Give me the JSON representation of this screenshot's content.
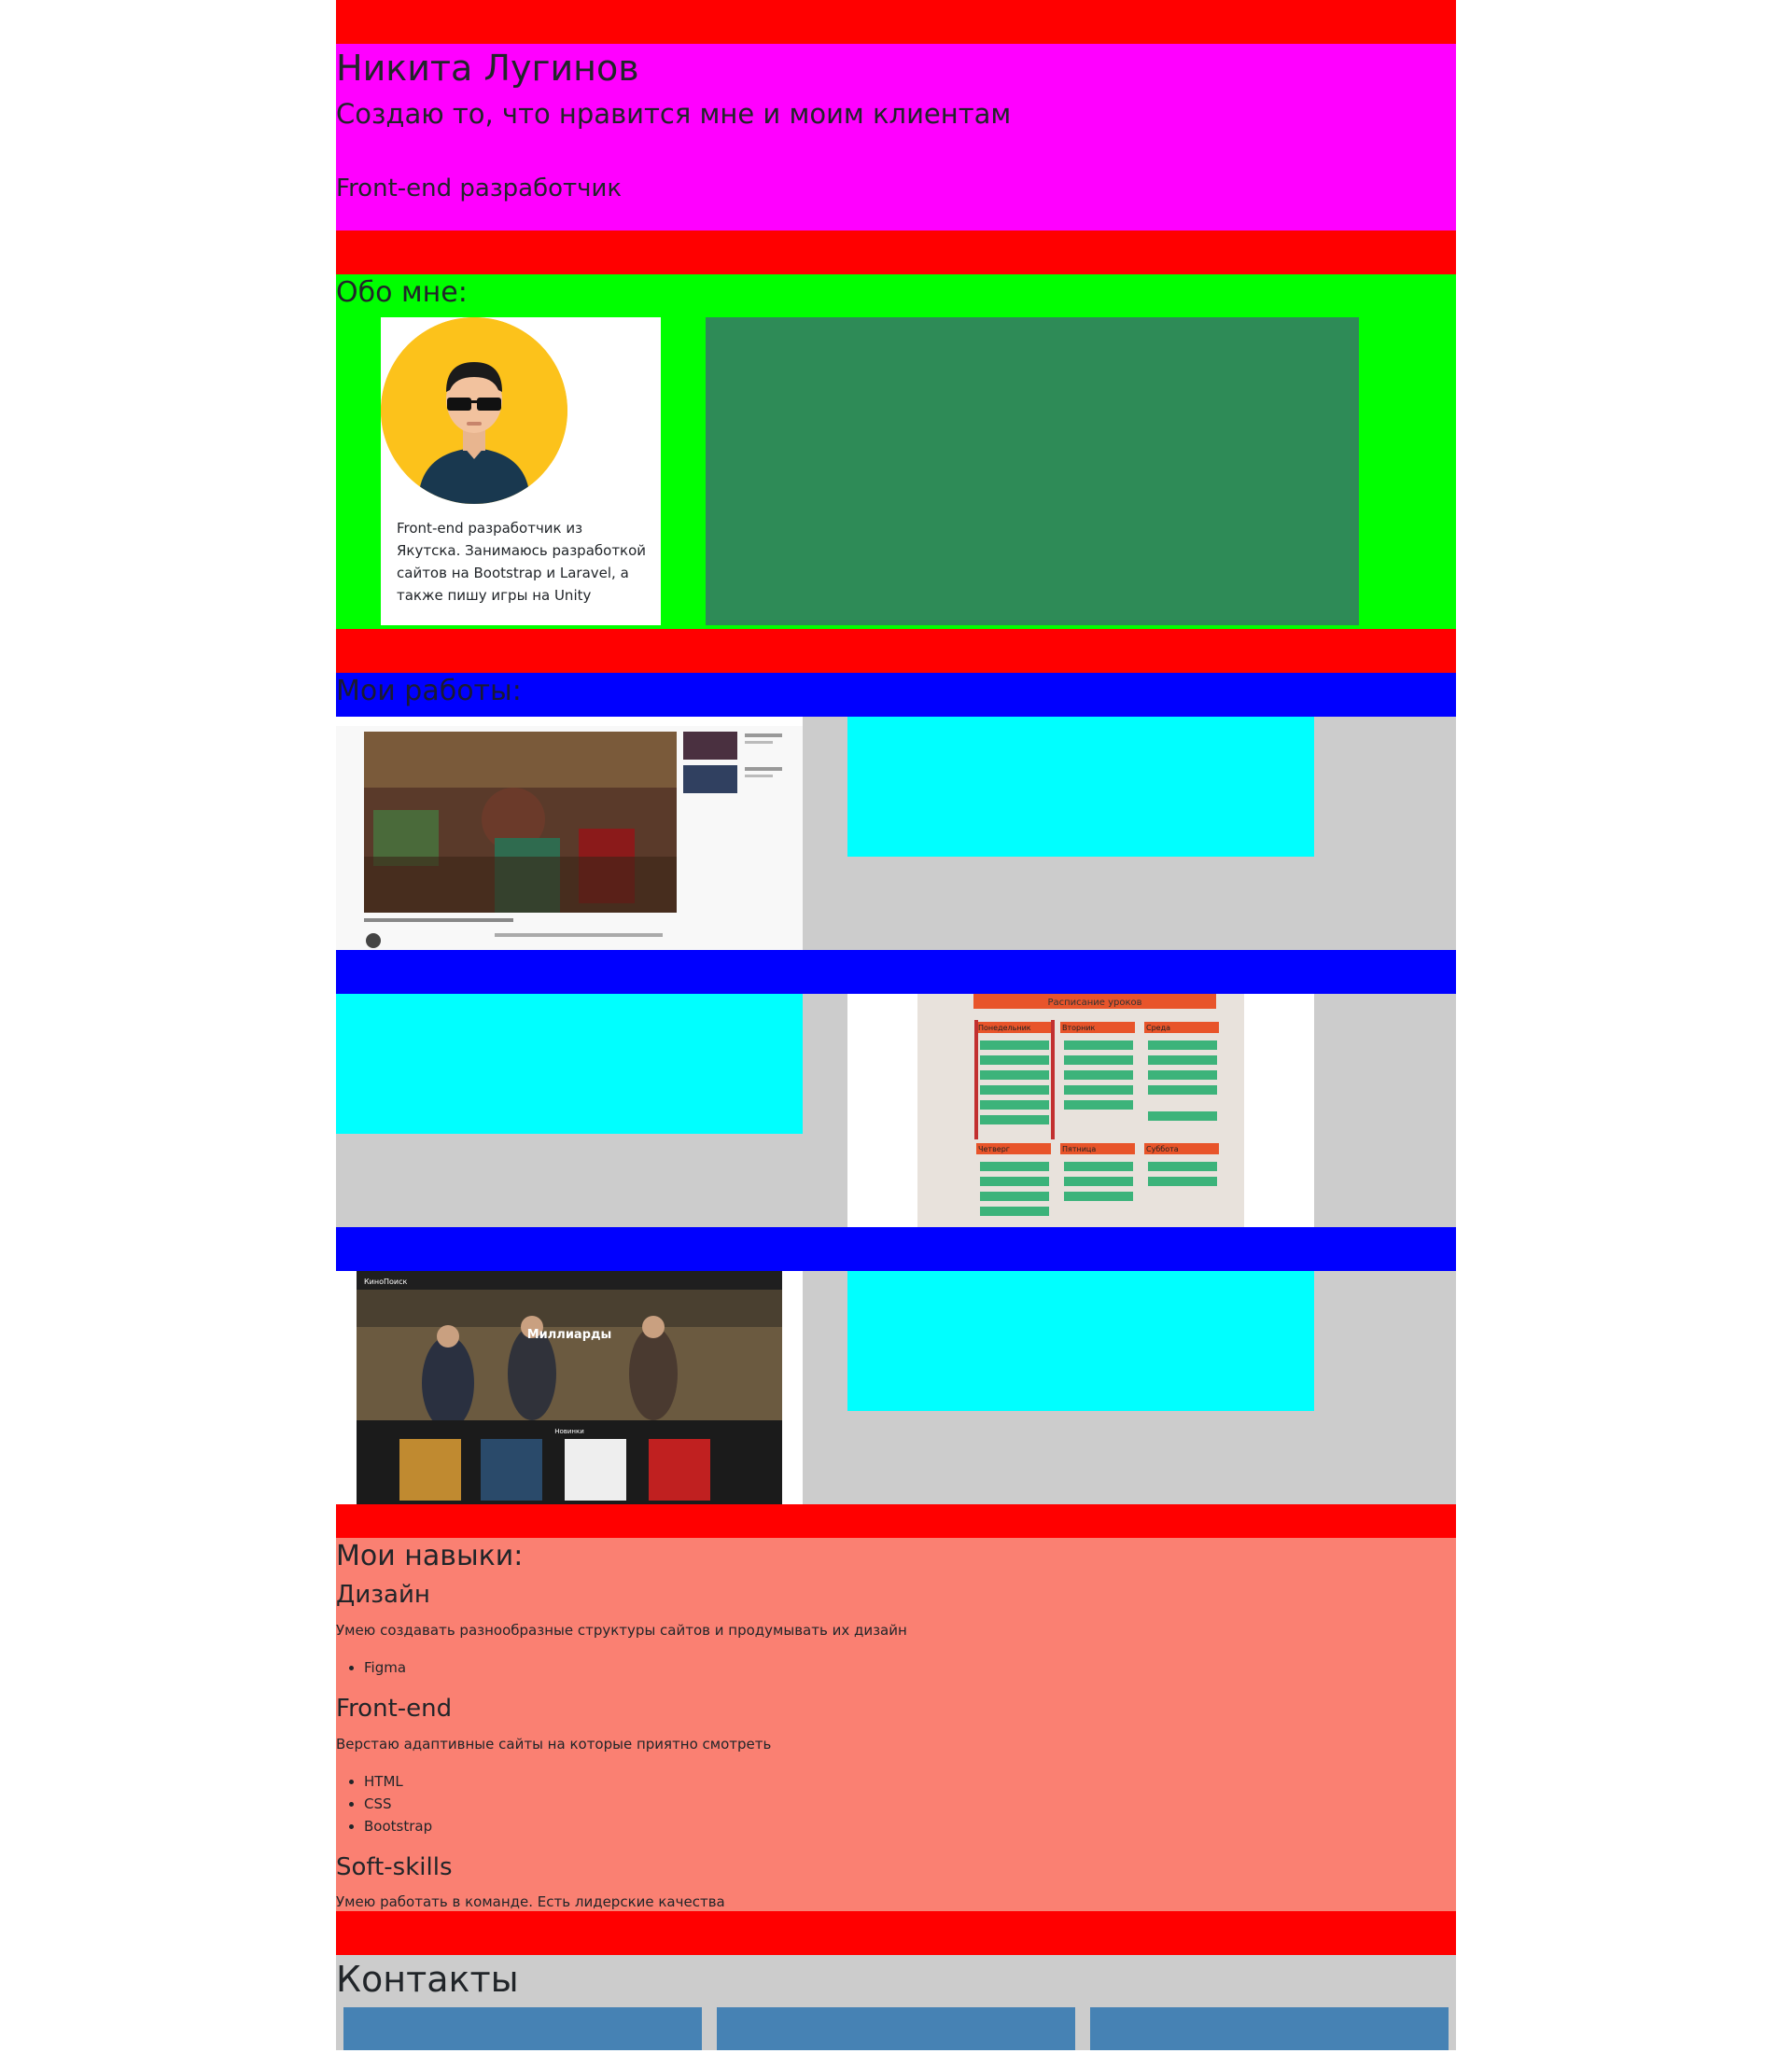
{
  "header": {
    "name": "Никита Лугинов",
    "tagline": "Создаю то, что нравится мне и моим клиентам",
    "role": "Front-end разработчик"
  },
  "about": {
    "title": "Обо мне:",
    "description": "Front-end разработчик из Якутска. Занимаюсь разработкой сайтов на Bootstrap и Laravel, а также пишу игры на Unity"
  },
  "works": {
    "title": "Мои работы:",
    "items": [
      {
        "image": "youtube-clone-screenshot"
      },
      {
        "image": "schedule-screenshot",
        "caption": "Расписание уроков",
        "days": [
          "Понедельник",
          "Вторник",
          "Среда",
          "Четверг",
          "Пятница",
          "Суббота"
        ]
      },
      {
        "image": "kinopoisk-clone-screenshot",
        "brand": "КиноПоиск",
        "movie": "Миллиарды",
        "section": "Новинки"
      }
    ]
  },
  "skills": {
    "title": "Мои навыки:",
    "groups": [
      {
        "name": "Дизайн",
        "description": "Умею создавать разнообразные структуры сайтов и продумывать их дизайн",
        "items": [
          "Figma"
        ]
      },
      {
        "name": "Front-end",
        "description": "Верстаю адаптивные сайты на которые приятно смотреть",
        "items": [
          "HTML",
          "CSS",
          "Bootstrap"
        ]
      },
      {
        "name": "Soft-skills",
        "description": "Умею работать в команде. Есть лидерские качества",
        "items": []
      }
    ]
  },
  "contacts": {
    "title": "Контакты"
  },
  "colors": {
    "spacer": "#ff0000",
    "hero": "#ff00ff",
    "about": "#00ff00",
    "about_box": "#2e8b57",
    "works_bar": "#0000ff",
    "works_bg": "#cccccc",
    "cyan_box": "#00ffff",
    "skills": "#fa8072",
    "contact_box": "#4682b4"
  }
}
